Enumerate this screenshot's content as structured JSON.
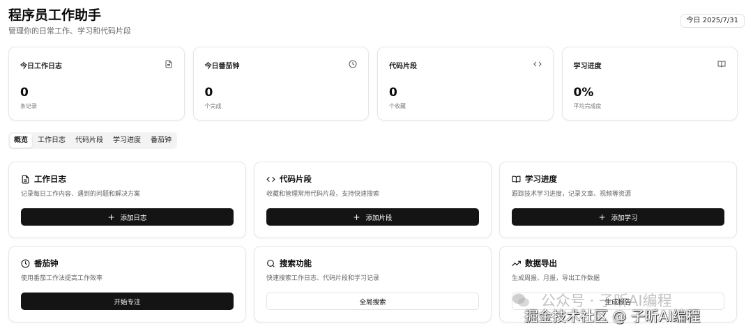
{
  "header": {
    "title": "程序员工作助手",
    "subtitle": "管理你的日常工作、学习和代码片段",
    "date": "今日 2025/7/31"
  },
  "stats": [
    {
      "label": "今日工作日志",
      "value": "0",
      "caption": "条记录",
      "icon": "document-icon"
    },
    {
      "label": "今日番茄钟",
      "value": "0",
      "caption": "个完成",
      "icon": "clock-icon"
    },
    {
      "label": "代码片段",
      "value": "0",
      "caption": "个收藏",
      "icon": "code-icon"
    },
    {
      "label": "学习进度",
      "value": "0%",
      "caption": "平均完成度",
      "icon": "book-icon"
    }
  ],
  "tabs": [
    "概览",
    "工作日志",
    "代码片段",
    "学习进度",
    "番茄钟"
  ],
  "active_tab": "概览",
  "cards": [
    {
      "title": "工作日志",
      "desc": "记录每日工作内容、遇到的问题和解决方案",
      "button": "添加日志",
      "icon": "document-icon"
    },
    {
      "title": "代码片段",
      "desc": "收藏和管理常用代码片段，支持快速搜索",
      "button": "添加片段",
      "icon": "code-icon"
    },
    {
      "title": "学习进度",
      "desc": "跟踪技术学习进度，记录文章、视频等资源",
      "button": "添加学习",
      "icon": "book-icon"
    },
    {
      "title": "番茄钟",
      "desc": "使用番茄工作法提高工作效率",
      "button": "开始专注",
      "icon": "clock-icon"
    },
    {
      "title": "搜索功能",
      "desc": "快速搜索工作日志、代码片段和学习记录",
      "button": "全局搜索",
      "icon": "search-icon"
    },
    {
      "title": "数据导出",
      "desc": "生成周报、月报，导出工作数据",
      "button": "生成报告",
      "icon": "trending-up-icon"
    }
  ],
  "watermark": {
    "top": "公众号 · 子昕AI编程",
    "bottom": "掘金技术社区 @ 子昕AI编程",
    "icon": "wechat-icon"
  },
  "colors": {
    "primary_button": "#141414",
    "border": "#e6e6e6",
    "muted_text": "#666666"
  }
}
